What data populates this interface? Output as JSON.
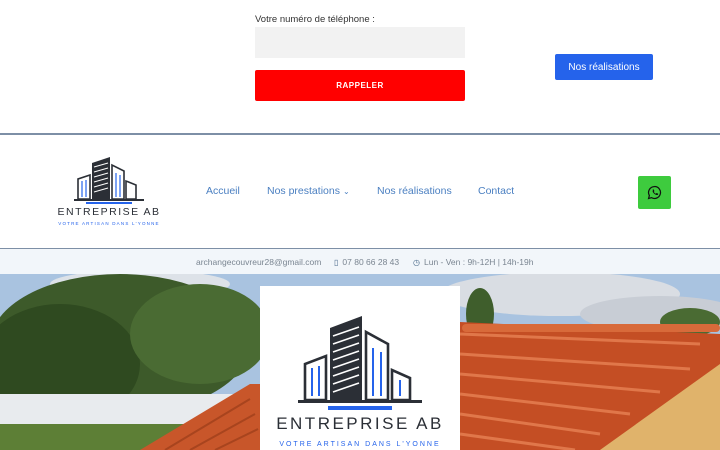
{
  "form": {
    "phone_label": "Votre numéro de téléphone :",
    "phone_value": "",
    "callback_label": "RAPPELER"
  },
  "cta": {
    "realisations_label": "Nos réalisations"
  },
  "brand": {
    "name": "ENTREPRISE AB",
    "tagline": "VOTRE ARTISAN DANS L'YONNE",
    "accent": "#2563eb"
  },
  "nav": {
    "items": [
      {
        "label": "Accueil"
      },
      {
        "label": "Nos prestations"
      },
      {
        "label": "Nos réalisations"
      },
      {
        "label": "Contact"
      }
    ]
  },
  "info": {
    "email": "archangecouvreur28@gmail.com",
    "phone": "07 80 66 28 43",
    "hours": "Lun - Ven : 9h-12H | 14h-19h"
  },
  "icons": {
    "whatsapp": "whatsapp-icon",
    "phone": "mobile-phone-icon",
    "clock": "clock-icon",
    "caret": "chevron-down-icon"
  },
  "colors": {
    "callback": "#ff0000",
    "cta": "#2563eb",
    "whatsapp": "#3ecb3e",
    "nav": "#4a7fc1"
  }
}
